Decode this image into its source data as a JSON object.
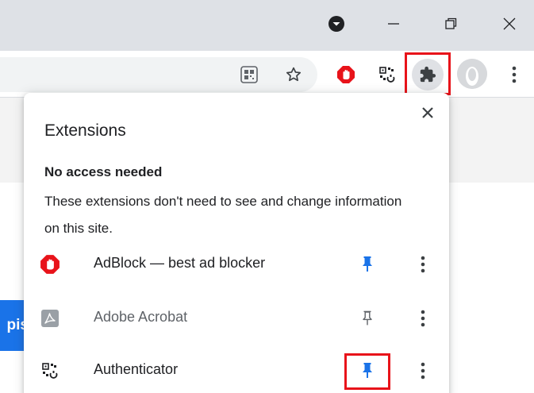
{
  "window": {
    "profile_icon": "circle-chevron-down-icon",
    "minimize_icon": "minimize-icon",
    "restore_icon": "restore-icon",
    "close_icon": "close-icon"
  },
  "toolbar": {
    "qr_icon": "qr-code-icon",
    "bookmark_icon": "star-icon",
    "adblock_icon": "adblock-hand-icon",
    "authenticator_icon": "authenticator-qr-icon",
    "extensions_icon": "puzzle-piece-icon",
    "avatar_icon": "avatar-icon",
    "menu_icon": "kebab-menu-icon"
  },
  "page": {
    "button_text": "pis"
  },
  "extensions_popup": {
    "title": "Extensions",
    "close_icon": "close-icon",
    "section_title": "No access needed",
    "section_description": "These extensions don't need to see and change information on this site.",
    "items": [
      {
        "name": "AdBlock — best ad blocker",
        "icon": "adblock-hand-icon",
        "pinned": true
      },
      {
        "name": "Adobe Acrobat",
        "icon": "acrobat-icon",
        "pinned": false
      },
      {
        "name": "Authenticator",
        "icon": "authenticator-qr-icon",
        "pinned": true
      }
    ]
  },
  "colors": {
    "titlebar": "#dee1e6",
    "pin_active": "#1a73e8",
    "pin_inactive": "#5f6368",
    "highlight": "#e8131a",
    "adblock_red": "#e8131a"
  }
}
